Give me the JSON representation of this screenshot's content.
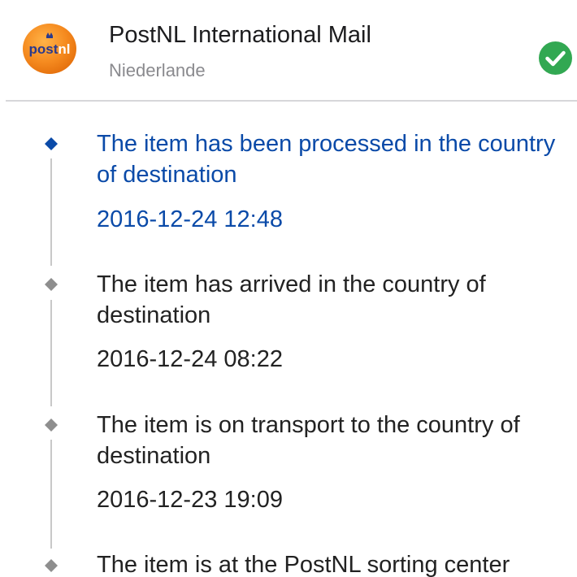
{
  "carrier": {
    "name": "PostNL International Mail",
    "country": "Niederlande",
    "logo_text": "postnl",
    "logo_color": "#f58a1f",
    "status_color": "#32a852"
  },
  "events": [
    {
      "description": "The item has been processed in the country of destination",
      "timestamp": "2016-12-24 12:48",
      "current": true
    },
    {
      "description": "The item has arrived in the country of destination",
      "timestamp": "2016-12-24 08:22",
      "current": false
    },
    {
      "description": "The item is on transport to the country of destination",
      "timestamp": "2016-12-23 19:09",
      "current": false
    },
    {
      "description": "The item is at the PostNL sorting center",
      "timestamp": "",
      "current": false
    }
  ],
  "colors": {
    "current_event": "#0a4aa8",
    "past_event": "#222222",
    "marker_past": "#8e8e8e",
    "marker_current": "#0a4aa8"
  }
}
